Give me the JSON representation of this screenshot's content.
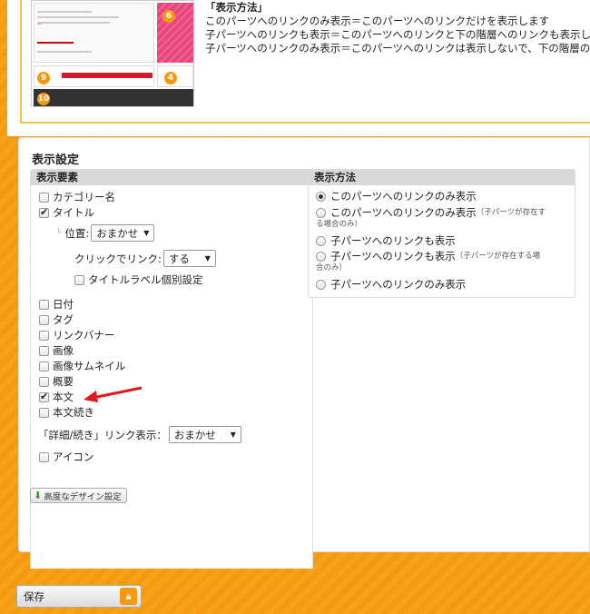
{
  "description": {
    "title": "「表示方法」",
    "lines": [
      "このパーツへのリンクのみ表示＝このパーツへのリンクだけを表示します",
      "子パーツへのリンクも表示＝このパーツへのリンクと下の階層へのリンクも表示します",
      "子パーツへのリンクのみ表示＝このパーツへのリンクは表示しないで、下の階層のリンクだ"
    ]
  },
  "thumbnail": {
    "badges": [
      "6",
      "9",
      "4",
      "10"
    ]
  },
  "settings": {
    "heading": "表示設定",
    "elements": {
      "header": "表示要素",
      "category": "カテゴリー名",
      "title": "タイトル",
      "position_label": "位置:",
      "position_value": "おまかせ",
      "click_link_label": "クリックでリンク:",
      "click_link_value": "する",
      "title_label_custom": "タイトルラベル個別設定",
      "date": "日付",
      "tag": "タグ",
      "link_banner": "リンクバナー",
      "image": "画像",
      "image_thumb": "画像サムネイル",
      "summary": "概要",
      "body": "本文",
      "body_more": "本文続き",
      "detail_link_label": "「詳細/続き」リンク表示：",
      "detail_link_value": "おまかせ",
      "icon": "アイコン"
    },
    "method": {
      "header": "表示方法",
      "opt1": "このパーツへのリンクのみ表示",
      "opt2": "このパーツへのリンクのみ表示",
      "opt2_note1": "（子パーツが存在す",
      "opt2_note2": "る場合のみ）",
      "opt3": "子パーツへのリンクも表示",
      "opt4": "子パーツへのリンクも表示",
      "opt4_note1": "（子パーツが存在する場",
      "opt4_note2": "合のみ）",
      "opt5": "子パーツへのリンクのみ表示"
    },
    "advanced_button": "高度なデザイン設定"
  },
  "save_button": "保存",
  "colors": {
    "accent": "#f39a10",
    "arrow": "#e0191e"
  }
}
